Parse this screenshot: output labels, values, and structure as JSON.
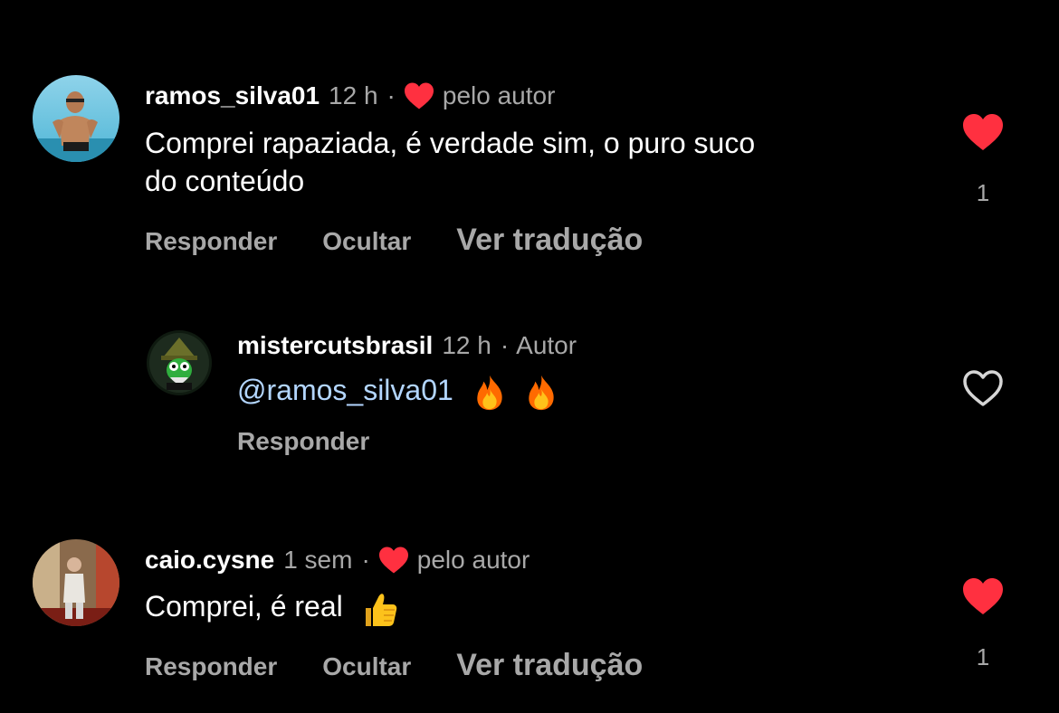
{
  "theme": {
    "background": "#000000",
    "text": "#ffffff",
    "muted": "#a8a8a8",
    "mention": "#b3d6ff",
    "heart": "#ff3040"
  },
  "comments": [
    {
      "username": "ramos_silva01",
      "time": "12 h",
      "separator": "·",
      "author_liked_label": "pelo autor",
      "text_lines": [
        "Comprei rapaziada, é verdade sim, o puro suco",
        "do conteúdo"
      ],
      "actions": {
        "reply": "Responder",
        "hide": "Ocultar",
        "translate": "Ver tradução"
      },
      "like_icon": "heart-filled-icon",
      "like_count": "1"
    },
    {
      "username": "mistercutsbrasil",
      "time": "12 h",
      "separator": "·",
      "author_badge": "Autor",
      "mention": "@ramos_silva01",
      "emojis": [
        "fire-emoji",
        "fire-emoji"
      ],
      "actions": {
        "reply": "Responder"
      },
      "like_icon": "heart-outline-icon"
    },
    {
      "username": "caio.cysne",
      "time": "1 sem",
      "separator": "·",
      "author_liked_label": "pelo autor",
      "text": "Comprei, é real",
      "emoji": "thumbs-up-emoji",
      "actions": {
        "reply": "Responder",
        "hide": "Ocultar",
        "translate": "Ver tradução"
      },
      "like_icon": "heart-filled-icon",
      "like_count": "1"
    }
  ]
}
